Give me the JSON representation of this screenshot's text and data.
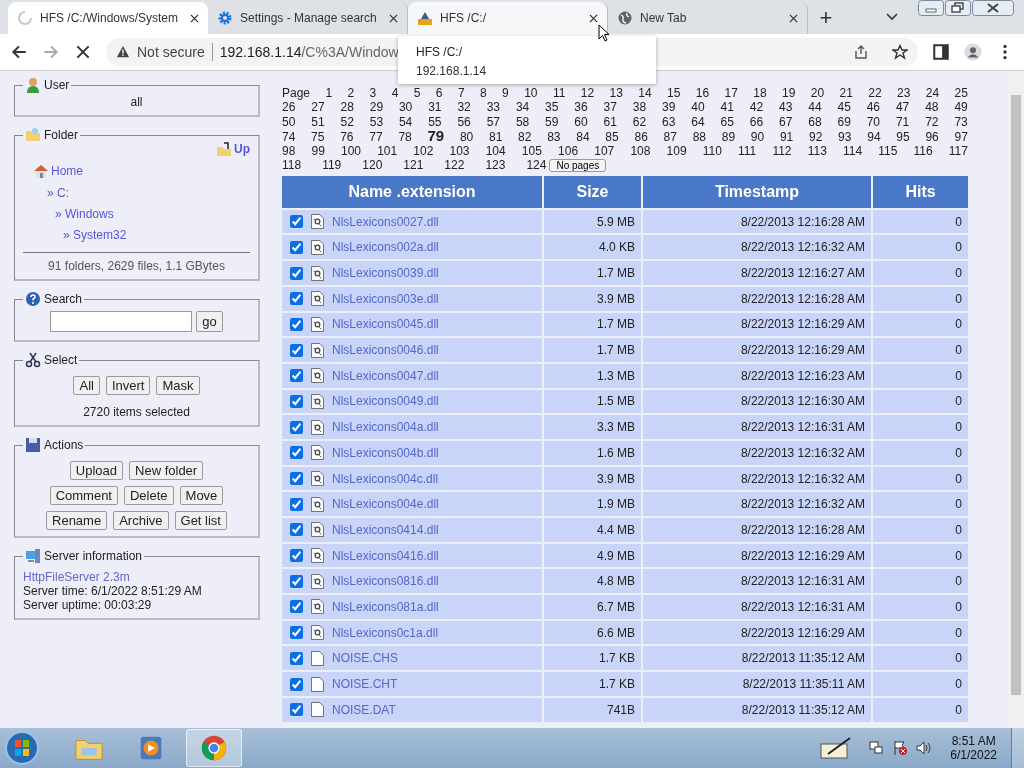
{
  "browser": {
    "tabs": [
      {
        "title": "HFS /C:/Windows/System",
        "kind": "loading",
        "selected": true,
        "hovered": false
      },
      {
        "title": "Settings - Manage search",
        "kind": "gear",
        "selected": false,
        "hovered": false
      },
      {
        "title": "HFS /C:/",
        "kind": "hfs",
        "selected": false,
        "hovered": true
      },
      {
        "title": "New Tab",
        "kind": "globe",
        "selected": false,
        "hovered": false
      }
    ],
    "new_tab": "+",
    "tooltip": {
      "title": "HFS /C:/",
      "subtitle": "192.168.1.14"
    },
    "address": {
      "security": "Not secure",
      "host": "192.168.1.14",
      "path": "/C%3A/Window"
    }
  },
  "sidebar": {
    "user": {
      "legend": "User",
      "name": "all"
    },
    "folder": {
      "legend": "Folder",
      "up": "Up",
      "path": [
        {
          "label": "Home",
          "children": [
            {
              "label": "» C:",
              "children": [
                {
                  "label": "» Windows",
                  "children": [
                    {
                      "label": "» System32"
                    }
                  ]
                }
              ]
            }
          ]
        }
      ],
      "summary": "91 folders, 2629 files, 1.1 GBytes"
    },
    "search": {
      "legend": "Search",
      "button": "go"
    },
    "select": {
      "legend": "Select",
      "buttons": [
        "All",
        "Invert",
        "Mask"
      ],
      "status": "2720 items selected"
    },
    "actions": {
      "legend": "Actions",
      "rows": [
        [
          "Upload",
          "New folder"
        ],
        [
          "Comment",
          "Delete",
          "Move"
        ],
        [
          "Rename",
          "Archive",
          "Get list"
        ]
      ]
    },
    "server": {
      "legend": "Server information",
      "link": "HttpFileServer 2.3m",
      "lines": [
        "Server time: 6/1/2022 8:51:29 AM",
        "Server uptime: 00:03:29"
      ]
    }
  },
  "pages": {
    "label": "Page",
    "button": "No pages",
    "links": [
      {
        "label": "1",
        "selected": false
      },
      {
        "label": "2",
        "selected": false
      },
      {
        "label": "3",
        "selected": false
      },
      {
        "label": "4",
        "selected": false
      },
      {
        "label": "5",
        "selected": false
      },
      {
        "label": "6",
        "selected": false
      },
      {
        "label": "7",
        "selected": false
      },
      {
        "label": "8",
        "selected": false
      },
      {
        "label": "9",
        "selected": false
      },
      {
        "label": "10",
        "selected": false
      },
      {
        "label": "11",
        "selected": false
      },
      {
        "label": "12",
        "selected": false
      },
      {
        "label": "13",
        "selected": false
      },
      {
        "label": "14",
        "selected": false
      },
      {
        "label": "15",
        "selected": false
      },
      {
        "label": "16",
        "selected": false
      },
      {
        "label": "17",
        "selected": false
      },
      {
        "label": "18",
        "selected": false
      },
      {
        "label": "19",
        "selected": false
      },
      {
        "label": "20",
        "selected": false
      },
      {
        "label": "21",
        "selected": false
      },
      {
        "label": "22",
        "selected": false
      },
      {
        "label": "23",
        "selected": false
      },
      {
        "label": "24",
        "selected": false
      },
      {
        "label": "25",
        "selected": false
      },
      {
        "label": "26",
        "selected": false
      },
      {
        "label": "27",
        "selected": false
      },
      {
        "label": "28",
        "selected": false
      },
      {
        "label": "29",
        "selected": false
      },
      {
        "label": "30",
        "selected": false
      },
      {
        "label": "31",
        "selected": false
      },
      {
        "label": "32",
        "selected": false
      },
      {
        "label": "33",
        "selected": false
      },
      {
        "label": "34",
        "selected": false
      },
      {
        "label": "35",
        "selected": false
      },
      {
        "label": "36",
        "selected": false
      },
      {
        "label": "37",
        "selected": false
      },
      {
        "label": "38",
        "selected": false
      },
      {
        "label": "39",
        "selected": false
      },
      {
        "label": "40",
        "selected": false
      },
      {
        "label": "41",
        "selected": false
      },
      {
        "label": "42",
        "selected": false
      },
      {
        "label": "43",
        "selected": false
      },
      {
        "label": "44",
        "selected": false
      },
      {
        "label": "45",
        "selected": false
      },
      {
        "label": "46",
        "selected": false
      },
      {
        "label": "47",
        "selected": false
      },
      {
        "label": "48",
        "selected": false
      },
      {
        "label": "49",
        "selected": false
      },
      {
        "label": "50",
        "selected": false
      },
      {
        "label": "51",
        "selected": false
      },
      {
        "label": "52",
        "selected": false
      },
      {
        "label": "53",
        "selected": false
      },
      {
        "label": "54",
        "selected": false
      },
      {
        "label": "55",
        "selected": false
      },
      {
        "label": "56",
        "selected": false
      },
      {
        "label": "57",
        "selected": false
      },
      {
        "label": "58",
        "selected": false
      },
      {
        "label": "59",
        "selected": false
      },
      {
        "label": "60",
        "selected": false
      },
      {
        "label": "61",
        "selected": false
      },
      {
        "label": "62",
        "selected": false
      },
      {
        "label": "63",
        "selected": false
      },
      {
        "label": "64",
        "selected": false
      },
      {
        "label": "65",
        "selected": false
      },
      {
        "label": "66",
        "selected": false
      },
      {
        "label": "67",
        "selected": false
      },
      {
        "label": "68",
        "selected": false
      },
      {
        "label": "69",
        "selected": false
      },
      {
        "label": "70",
        "selected": false
      },
      {
        "label": "71",
        "selected": false
      },
      {
        "label": "72",
        "selected": false
      },
      {
        "label": "73",
        "selected": false
      },
      {
        "label": "74",
        "selected": false
      },
      {
        "label": "75",
        "selected": false
      },
      {
        "label": "76",
        "selected": false
      },
      {
        "label": "77",
        "selected": false
      },
      {
        "label": "78",
        "selected": false
      },
      {
        "label": "79",
        "selected": true
      },
      {
        "label": "80",
        "selected": false
      },
      {
        "label": "81",
        "selected": false
      },
      {
        "label": "82",
        "selected": false
      },
      {
        "label": "83",
        "selected": false
      },
      {
        "label": "84",
        "selected": false
      },
      {
        "label": "85",
        "selected": false
      },
      {
        "label": "86",
        "selected": false
      },
      {
        "label": "87",
        "selected": false
      },
      {
        "label": "88",
        "selected": false
      },
      {
        "label": "89",
        "selected": false
      },
      {
        "label": "90",
        "selected": false
      },
      {
        "label": "91",
        "selected": false
      },
      {
        "label": "92",
        "selected": false
      },
      {
        "label": "93",
        "selected": false
      },
      {
        "label": "94",
        "selected": false
      },
      {
        "label": "95",
        "selected": false
      },
      {
        "label": "96",
        "selected": false
      },
      {
        "label": "97",
        "selected": false
      },
      {
        "label": "98",
        "selected": false
      },
      {
        "label": "99",
        "selected": false
      },
      {
        "label": "100",
        "selected": false
      },
      {
        "label": "101",
        "selected": false
      },
      {
        "label": "102",
        "selected": false
      },
      {
        "label": "103",
        "selected": false
      },
      {
        "label": "104",
        "selected": false
      },
      {
        "label": "105",
        "selected": false
      },
      {
        "label": "106",
        "selected": false
      },
      {
        "label": "107",
        "selected": false
      },
      {
        "label": "108",
        "selected": false
      },
      {
        "label": "109",
        "selected": false
      },
      {
        "label": "110",
        "selected": false
      },
      {
        "label": "111",
        "selected": false
      },
      {
        "label": "112",
        "selected": false
      },
      {
        "label": "113",
        "selected": false
      },
      {
        "label": "114",
        "selected": false
      },
      {
        "label": "115",
        "selected": false
      },
      {
        "label": "116",
        "selected": false
      },
      {
        "label": "117",
        "selected": false
      },
      {
        "label": "118",
        "selected": false
      },
      {
        "label": "119",
        "selected": false
      },
      {
        "label": "120",
        "selected": false
      },
      {
        "label": "121",
        "selected": false
      },
      {
        "label": "122",
        "selected": false
      },
      {
        "label": "123",
        "selected": false
      },
      {
        "label": "124",
        "selected": false
      }
    ]
  },
  "table": {
    "columns": [
      "Name .extension",
      "Size",
      "Timestamp",
      "Hits"
    ],
    "rows": [
      {
        "checked": true,
        "kind": "dll",
        "name": "NlsLexicons0027.dll",
        "size": "5.9 MB",
        "timestamp": "8/22/2013 12:16:28 AM",
        "hits": "0"
      },
      {
        "checked": true,
        "kind": "dll",
        "name": "NlsLexicons002a.dll",
        "size": "4.0 KB",
        "timestamp": "8/22/2013 12:16:32 AM",
        "hits": "0"
      },
      {
        "checked": true,
        "kind": "dll",
        "name": "NlsLexicons0039.dll",
        "size": "1.7 MB",
        "timestamp": "8/22/2013 12:16:27 AM",
        "hits": "0"
      },
      {
        "checked": true,
        "kind": "dll",
        "name": "NlsLexicons003e.dll",
        "size": "3.9 MB",
        "timestamp": "8/22/2013 12:16:28 AM",
        "hits": "0"
      },
      {
        "checked": true,
        "kind": "dll",
        "name": "NlsLexicons0045.dll",
        "size": "1.7 MB",
        "timestamp": "8/22/2013 12:16:29 AM",
        "hits": "0"
      },
      {
        "checked": true,
        "kind": "dll",
        "name": "NlsLexicons0046.dll",
        "size": "1.7 MB",
        "timestamp": "8/22/2013 12:16:29 AM",
        "hits": "0"
      },
      {
        "checked": true,
        "kind": "dll",
        "name": "NlsLexicons0047.dll",
        "size": "1.3 MB",
        "timestamp": "8/22/2013 12:16:23 AM",
        "hits": "0"
      },
      {
        "checked": true,
        "kind": "dll",
        "name": "NlsLexicons0049.dll",
        "size": "1.5 MB",
        "timestamp": "8/22/2013 12:16:30 AM",
        "hits": "0"
      },
      {
        "checked": true,
        "kind": "dll",
        "name": "NlsLexicons004a.dll",
        "size": "3.3 MB",
        "timestamp": "8/22/2013 12:16:31 AM",
        "hits": "0"
      },
      {
        "checked": true,
        "kind": "dll",
        "name": "NlsLexicons004b.dll",
        "size": "1.6 MB",
        "timestamp": "8/22/2013 12:16:32 AM",
        "hits": "0"
      },
      {
        "checked": true,
        "kind": "dll",
        "name": "NlsLexicons004c.dll",
        "size": "3.9 MB",
        "timestamp": "8/22/2013 12:16:32 AM",
        "hits": "0"
      },
      {
        "checked": true,
        "kind": "dll",
        "name": "NlsLexicons004e.dll",
        "size": "1.9 MB",
        "timestamp": "8/22/2013 12:16:32 AM",
        "hits": "0"
      },
      {
        "checked": true,
        "kind": "dll",
        "name": "NlsLexicons0414.dll",
        "size": "4.4 MB",
        "timestamp": "8/22/2013 12:16:28 AM",
        "hits": "0"
      },
      {
        "checked": true,
        "kind": "dll",
        "name": "NlsLexicons0416.dll",
        "size": "4.9 MB",
        "timestamp": "8/22/2013 12:16:29 AM",
        "hits": "0"
      },
      {
        "checked": true,
        "kind": "dll",
        "name": "NlsLexicons0816.dll",
        "size": "4.8 MB",
        "timestamp": "8/22/2013 12:16:31 AM",
        "hits": "0"
      },
      {
        "checked": true,
        "kind": "dll",
        "name": "NlsLexicons081a.dll",
        "size": "6.7 MB",
        "timestamp": "8/22/2013 12:16:31 AM",
        "hits": "0"
      },
      {
        "checked": true,
        "kind": "dll",
        "name": "NlsLexicons0c1a.dll",
        "size": "6.6 MB",
        "timestamp": "8/22/2013 12:16:29 AM",
        "hits": "0"
      },
      {
        "checked": true,
        "kind": "file",
        "name": "NOISE.CHS",
        "size": "1.7 KB",
        "timestamp": "8/22/2013 11:35:12 AM",
        "hits": "0"
      },
      {
        "checked": true,
        "kind": "file",
        "name": "NOISE.CHT",
        "size": "1.7 KB",
        "timestamp": "8/22/2013 11:35:11 AM",
        "hits": "0"
      },
      {
        "checked": true,
        "kind": "file",
        "name": "NOISE.DAT",
        "size": "741B",
        "timestamp": "8/22/2013 11:35:12 AM",
        "hits": "0"
      }
    ]
  },
  "taskbar": {
    "apps": [
      {
        "kind": "folder",
        "selected": false
      },
      {
        "kind": "media",
        "selected": false
      },
      {
        "kind": "chrome",
        "selected": true
      }
    ],
    "clock": {
      "time": "8:51 AM",
      "date": "6/1/2022"
    }
  }
}
